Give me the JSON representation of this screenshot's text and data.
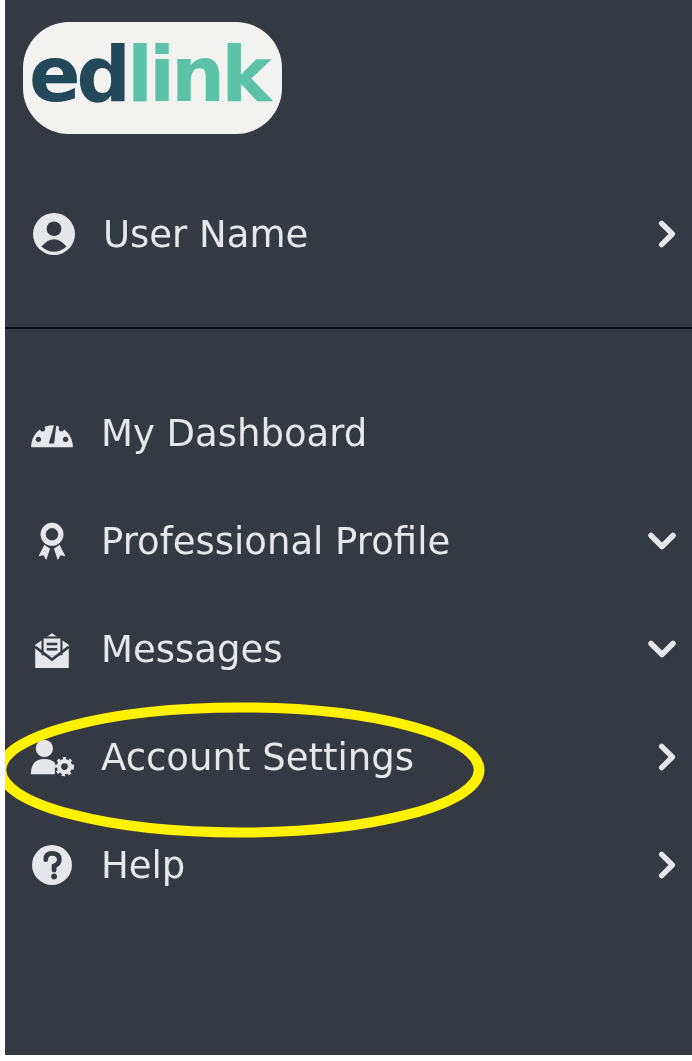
{
  "logo": {
    "parts": [
      "ed",
      "link"
    ]
  },
  "user": {
    "label": "User Name",
    "kind": "link"
  },
  "menu": [
    {
      "label": "My Dashboard",
      "kind": "plain",
      "circled": false
    },
    {
      "label": "Professional Profile",
      "kind": "dropdown",
      "circled": false
    },
    {
      "label": "Messages",
      "kind": "dropdown",
      "circled": false
    },
    {
      "label": "Account Settings",
      "kind": "link",
      "circled": true
    },
    {
      "label": "Help",
      "kind": "link",
      "circled": false
    }
  ]
}
